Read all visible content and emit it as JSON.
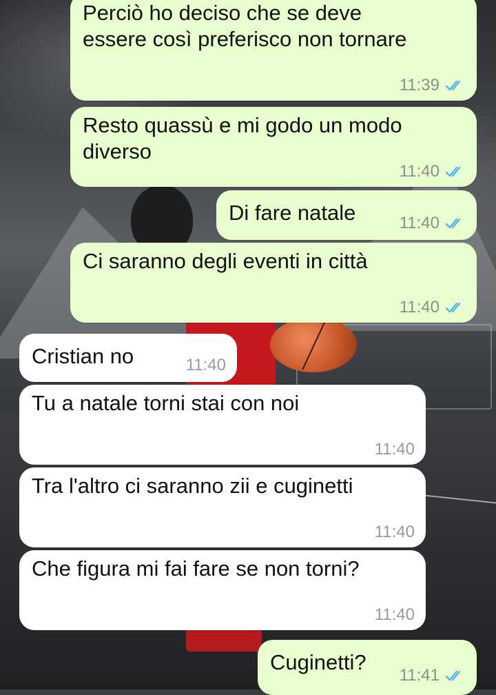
{
  "colors": {
    "outgoing_bubble": "#e8fecf",
    "incoming_bubble": "#ffffff",
    "read_ticks": "#4fb6ec",
    "time_text": "#8a8f8a"
  },
  "icons": {
    "read_status": "double-check-icon"
  },
  "messages": [
    {
      "direction": "outgoing",
      "text": "Perciò ho deciso che se deve\nessere così preferisco non tornare",
      "time": "11:39",
      "status": "read"
    },
    {
      "direction": "outgoing",
      "text": "Resto quassù e mi godo un modo\ndiverso",
      "time": "11:40",
      "status": "read"
    },
    {
      "direction": "outgoing",
      "text": "Di fare natale",
      "time": "11:40",
      "status": "read"
    },
    {
      "direction": "outgoing",
      "text": "Ci saranno degli eventi in città",
      "time": "11:40",
      "status": "read"
    },
    {
      "direction": "incoming",
      "text": "Cristian no",
      "time": "11:40"
    },
    {
      "direction": "incoming",
      "text": "Tu a natale torni stai con noi",
      "time": "11:40"
    },
    {
      "direction": "incoming",
      "text": "Tra l'altro ci saranno zii e cuginetti",
      "time": "11:40"
    },
    {
      "direction": "incoming",
      "text": "Che figura mi fai fare se non torni?",
      "time": "11:40"
    },
    {
      "direction": "outgoing",
      "text": "Cuginetti?",
      "time": "11:41",
      "status": "read"
    }
  ]
}
